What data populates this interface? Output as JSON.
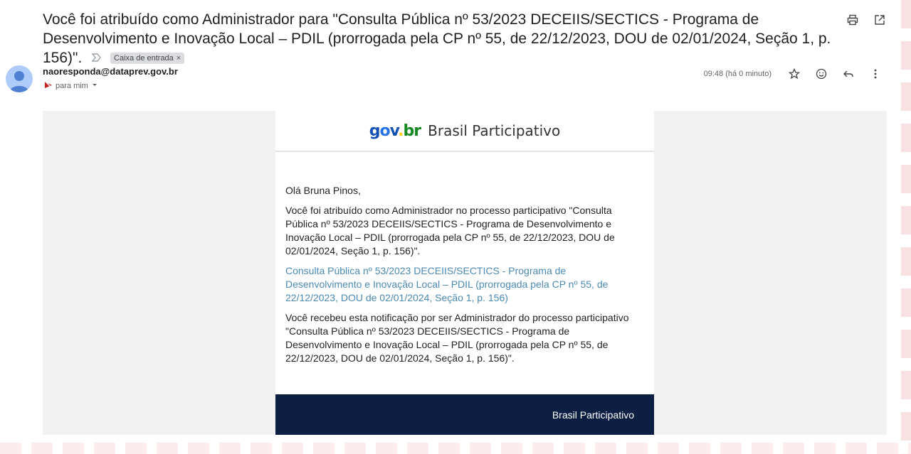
{
  "email": {
    "subject": "Você foi atribuído como Administrador para \"Consulta Pública nº 53/2023 DECEIIS/SECTICS - Programa de Desenvolvimento e Inovação Local – PDIL (prorrogada pela CP nº 55, de 22/12/2023, DOU de 02/01/2024, Seção 1, p. 156)\".",
    "label": "Caixa de entrada",
    "label_close": "×",
    "sender": "naoresponda@dataprev.gov.br",
    "recipient": "para mim",
    "time": "09:48 (há 0 minuto)"
  },
  "message": {
    "logo": {
      "g": "g",
      "o": "o",
      "v": "v",
      "dot": ".",
      "b": "b",
      "r": "r"
    },
    "brand_name": "Brasil Participativo",
    "greeting": "Olá Bruna Pinos,",
    "paragraph1": "Você foi atribuído como Administrador no processo participativo \"Consulta Pública nº 53/2023 DECEIIS/SECTICS - Programa de Desenvolvimento e Inovação Local – PDIL (prorrogada pela CP nº 55, de 22/12/2023, DOU de 02/01/2024, Seção 1, p. 156)\".",
    "link_text": "Consulta Pública nº 53/2023 DECEIIS/SECTICS - Programa de Desenvolvimento e Inovação Local – PDIL (prorrogada pela CP nº 55, de 22/12/2023, DOU de 02/01/2024, Seção 1, p. 156)",
    "paragraph2": "Você recebeu esta notificação por ser Administrador do processo participativo \"Consulta Pública nº 53/2023 DECEIIS/SECTICS - Programa de Desenvolvimento e Inovação Local – PDIL (prorrogada pela CP nº 55, de 22/12/2023, DOU de 02/01/2024, Seção 1, p. 156)\".",
    "footer": "Brasil Participativo"
  },
  "colors": {
    "footer_bg": "#0c1f43",
    "link": "#4b8ab3",
    "avatar": "#aecbfa"
  },
  "icons": [
    "print-icon",
    "open-new-window-icon",
    "important-marker-icon",
    "external-sender-icon",
    "chevron-down-icon",
    "star-icon",
    "emoji-icon",
    "reply-icon",
    "more-options-icon"
  ]
}
